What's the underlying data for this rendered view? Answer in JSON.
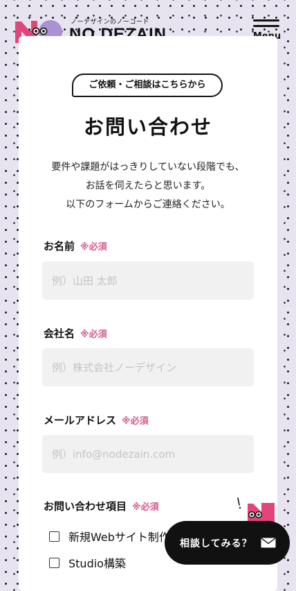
{
  "header": {
    "logo_tagline": "ノーデザインのノーコード",
    "logo_text": "NO DEZAIN.",
    "menu_label": "Menu"
  },
  "contact": {
    "tagline": "ご依頼・ご相談はこちらから",
    "title": "お問い合わせ",
    "intro_lines": [
      "要件や課題がはっきりしていない段階でも、",
      "お話を伺えたらと思います。",
      "以下のフォームからご連絡ください。"
    ],
    "fields": [
      {
        "label": "お名前",
        "required": "※必須",
        "placeholder": "例）山田 太郎"
      },
      {
        "label": "会社名",
        "required": "※必須",
        "placeholder": "例）株式会社ノーデザイン"
      },
      {
        "label": "メールアドレス",
        "required": "※必須",
        "placeholder": "例）info@nodezain.com"
      }
    ],
    "inquiry": {
      "label": "お問い合わせ項目",
      "required": "※必須",
      "options": [
        "新規Webサイト制作",
        "Studio構築"
      ]
    }
  },
  "floating": {
    "consult_label": "相談してみる？"
  },
  "colors": {
    "accent_pink": "#e3457a",
    "required_pink": "#d45b8d",
    "logo_purple": "#a991d3",
    "background": "#e8e4ef"
  },
  "icons": [
    "logo-mark-icon",
    "menu-icon",
    "mascot-icon",
    "mail-icon"
  ]
}
